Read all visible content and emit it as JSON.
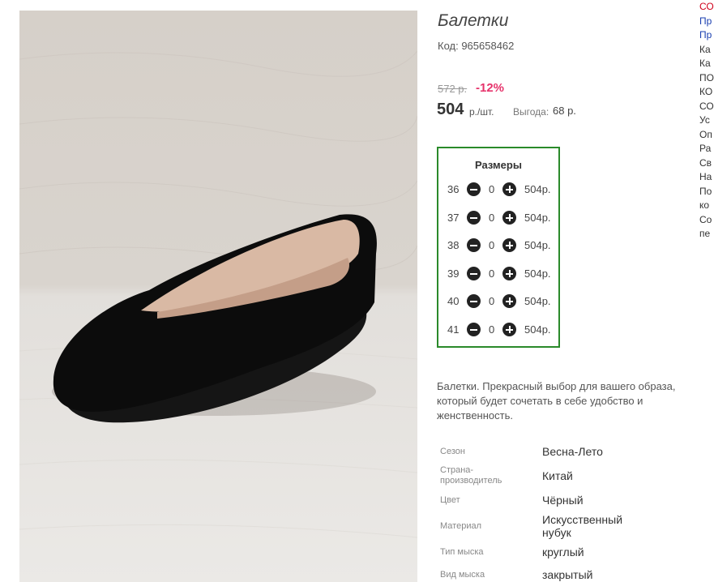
{
  "product": {
    "title": "Балетки",
    "code": "Код: 965658462",
    "old_price": "572 р.",
    "discount": "-12%",
    "price": "504",
    "price_unit": "р./шт.",
    "benefit_label": "Выгода:",
    "benefit_value": "68 р.",
    "description": "Балетки. Прекрасный выбор для вашего образа, который будет сочетать в себе удобство и женственность."
  },
  "sizes": {
    "title": "Размеры",
    "rows": [
      {
        "size": "36",
        "qty": "0",
        "price": "504р."
      },
      {
        "size": "37",
        "qty": "0",
        "price": "504р."
      },
      {
        "size": "38",
        "qty": "0",
        "price": "504р."
      },
      {
        "size": "39",
        "qty": "0",
        "price": "504р."
      },
      {
        "size": "40",
        "qty": "0",
        "price": "504р."
      },
      {
        "size": "41",
        "qty": "0",
        "price": "504р."
      }
    ]
  },
  "properties": [
    {
      "label": "Сезон",
      "value": "Весна-Лето"
    },
    {
      "label": "Страна-производитель",
      "value": "Китай"
    },
    {
      "label": "Цвет",
      "value": "Чёрный"
    },
    {
      "label": "Материал",
      "value": "Искусственный нубук"
    },
    {
      "label": "Тип мыска",
      "value": "круглый"
    },
    {
      "label": "Вид мыска",
      "value": "закрытый"
    }
  ],
  "right_nav": [
    "СО",
    "Пр",
    "Пр",
    "Ка",
    "Ка",
    "ПО",
    "КО",
    "СО",
    "Ус",
    "Оп",
    "Ра",
    "Св",
    "На",
    "По",
    "ко",
    "Со",
    "пе"
  ],
  "colors": {
    "accent_red": "#e6336b",
    "sizes_border": "#2a8a2a",
    "cart_button": "#b6e42a"
  },
  "icons": {
    "minus": "minus-circle-icon",
    "plus": "plus-circle-icon"
  }
}
